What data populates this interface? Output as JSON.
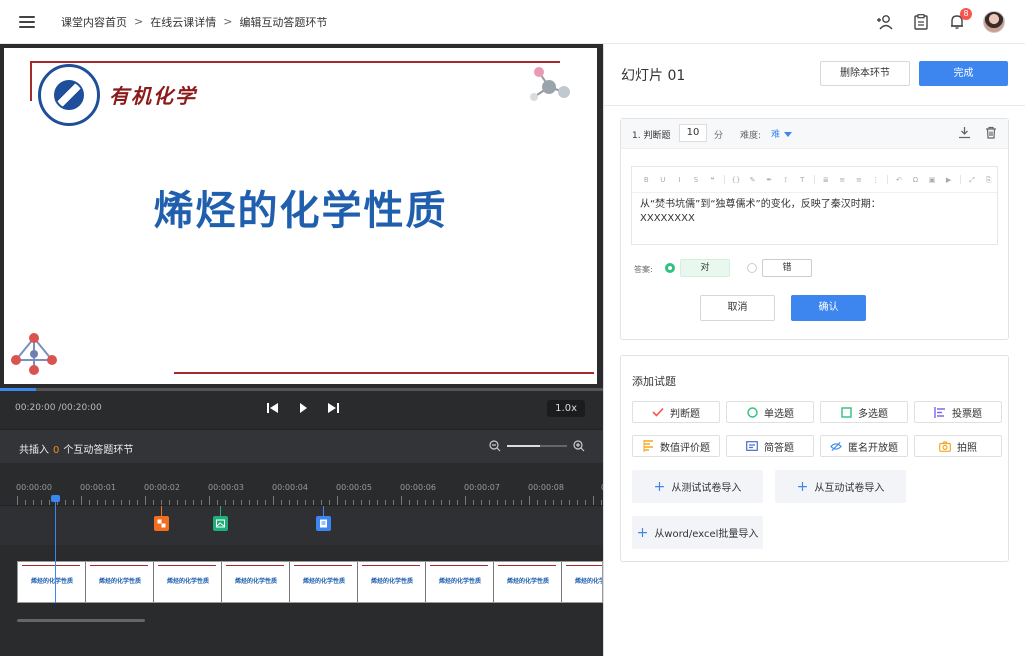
{
  "breadcrumb": [
    "课堂内容首页",
    "在线云课详情",
    "编辑互动答题环节"
  ],
  "breadcrumb_sep": ">",
  "header": {
    "notification_count": "8"
  },
  "slide": {
    "brand": "有机化学",
    "title": "烯烃的化学性质",
    "progress_fraction": 0.06
  },
  "player": {
    "time": "00:20:00 /00:20:00",
    "speed": "1.0x"
  },
  "insert_bar": {
    "prefix": "共插入",
    "count": "0",
    "suffix": "个互动答题环节",
    "zoom_fraction": 0.55
  },
  "ruler": {
    "labels": [
      "00:00:00",
      "00:00:01",
      "00:00:02",
      "00:00:03",
      "00:00:04",
      "00:00:05",
      "00:00:06",
      "00:00:07",
      "00:00:08",
      "00:0"
    ]
  },
  "timeline_markers": [
    {
      "name": "timeline-marker-vote",
      "color": "#f26f21"
    },
    {
      "name": "timeline-marker-photo",
      "color": "#1fb07a"
    },
    {
      "name": "timeline-marker-essay",
      "color": "#3d86f0"
    }
  ],
  "filmstrip": {
    "frame_title": "烯烃的化学性质",
    "frame_count": 9
  },
  "panel": {
    "slide_title": "幻灯片 01",
    "delete_label": "删除本环节",
    "done_label": "完成"
  },
  "question": {
    "type_label": "1. 判断题",
    "score": "10",
    "score_unit": "分",
    "difficulty_label": "难度:",
    "difficulty_value": "难",
    "toolbar_items": [
      "B",
      "U",
      "I",
      "S",
      "❝",
      "{}",
      "✎",
      "✒",
      "⟟",
      "T",
      "≣",
      "≡",
      "≡",
      "⋮",
      "↶",
      "Ω",
      "▣",
      "▶",
      "⤢",
      "⎘"
    ],
    "text_line1": "从“焚书坑儒”到“独尊儒术”的变化，反映了秦汉时期：",
    "text_line2": "XXXXXXXX",
    "answer_label": "答案:",
    "option_true": "对",
    "option_false": "错",
    "cancel_label": "取消",
    "confirm_label": "确认"
  },
  "add_section": {
    "title": "添加试题",
    "types": [
      {
        "label": "判断题",
        "icon": "check-mark-icon",
        "color": "#f5574f"
      },
      {
        "label": "单选题",
        "icon": "radio-circle-icon",
        "color": "#2ec27e"
      },
      {
        "label": "多选题",
        "icon": "checkbox-square-icon",
        "color": "#2ec27e"
      },
      {
        "label": "投票题",
        "icon": "vote-bars-icon",
        "color": "#7b68ee"
      },
      {
        "label": "数值评价题",
        "icon": "rating-list-icon",
        "color": "#f5a623"
      },
      {
        "label": "简答题",
        "icon": "short-answer-icon",
        "color": "#4a6ccf"
      },
      {
        "label": "匿名开放题",
        "icon": "anonymous-eye-icon",
        "color": "#3d86f0"
      },
      {
        "label": "拍照",
        "icon": "camera-icon",
        "color": "#f5a623"
      }
    ],
    "import_test": "从测试试卷导入",
    "import_interactive": "从互动试卷导入",
    "import_word": "从word/excel批量导入"
  }
}
